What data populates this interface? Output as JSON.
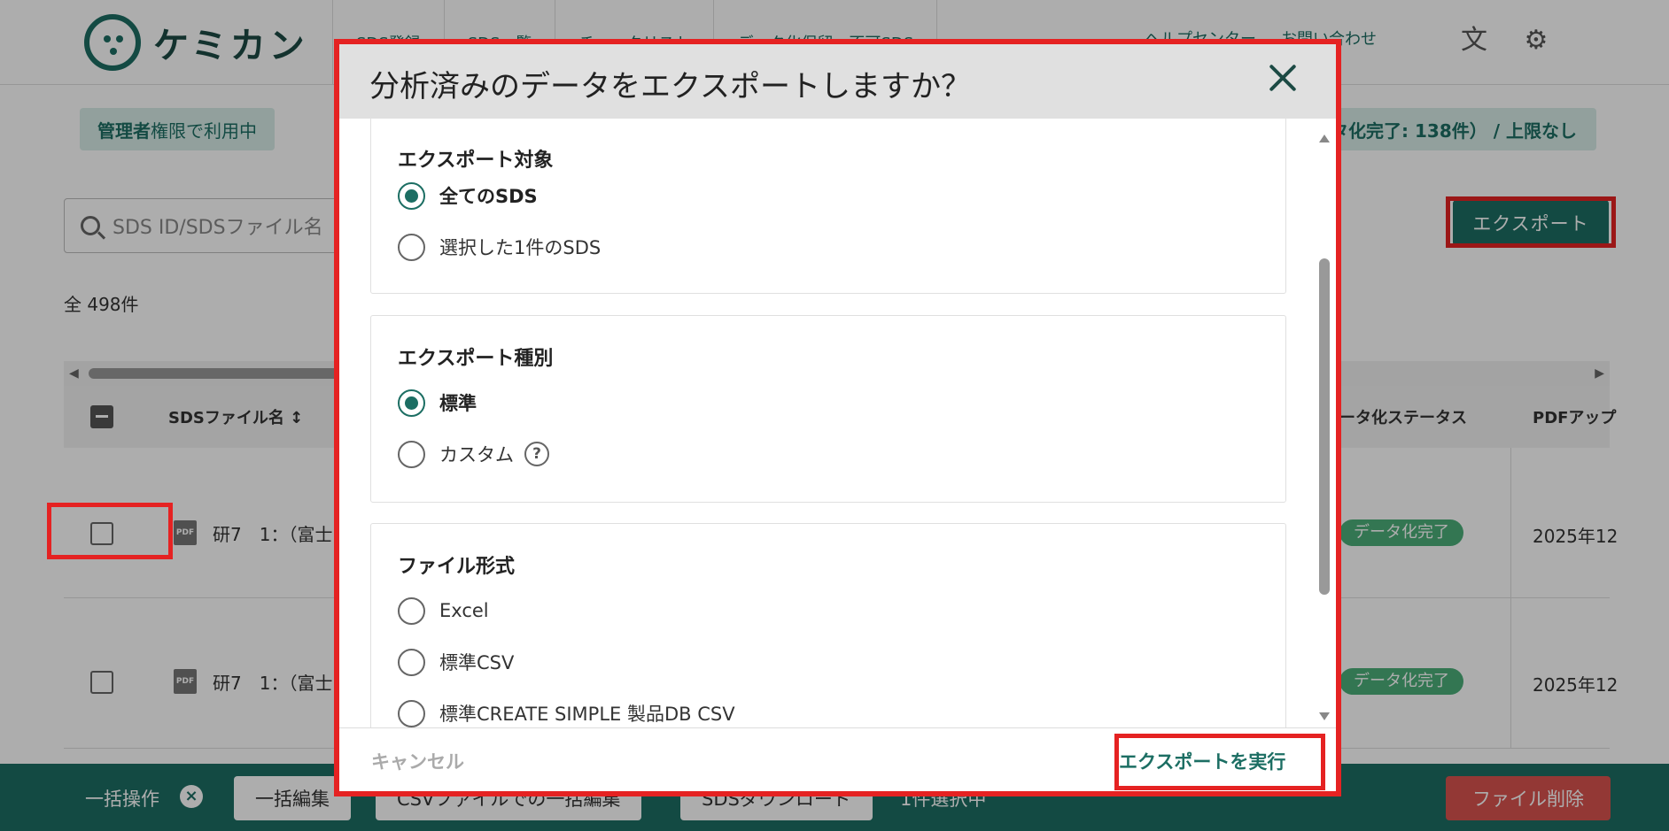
{
  "app": {
    "brand": "ケミカン",
    "nav": [
      "SDS登録",
      "SDS一覧",
      "チェックリスト",
      "データ化保留・不可SDS"
    ],
    "help_link": "ヘルプセンター",
    "contact_link": "お問い合わせ",
    "admin_badge_strong": "管理者",
    "admin_badge_rest": "権限で利用中",
    "quota_text": "タ化完了: 138件） / 上限なし",
    "search_placeholder": "SDS ID/SDSファイル名",
    "export_button": "エクスポート",
    "total_count": "全 498件"
  },
  "table": {
    "headers": {
      "filename": "SDSファイル名",
      "status": "ータ化ステータス",
      "uploaded": "PDFアップ"
    },
    "rows": [
      {
        "filename": "研7　1：（富士",
        "status": "データ化完了",
        "date": "2025年12"
      },
      {
        "filename": "研7　1：（富士",
        "status": "データ化完了",
        "date": "2025年12"
      }
    ]
  },
  "bulk_bar": {
    "label": "一括操作",
    "buttons": [
      "一括編集",
      "CSVファイルでの一括編集",
      "SDSダウンロード"
    ],
    "selected_count": "1件選択中",
    "delete_button": "ファイル削除"
  },
  "modal": {
    "title": "分析済みのデータをエクスポートしますか？",
    "sections": {
      "target": {
        "title": "エクスポート対象",
        "options": [
          {
            "label": "全てのSDS",
            "selected": true
          },
          {
            "label": "選択した1件のSDS",
            "selected": false
          }
        ]
      },
      "type": {
        "title": "エクスポート種別",
        "options": [
          {
            "label": "標準",
            "selected": true
          },
          {
            "label": "カスタム",
            "selected": false
          }
        ]
      },
      "format": {
        "title": "ファイル形式",
        "options": [
          {
            "label": "Excel",
            "selected": false
          },
          {
            "label": "標準CSV",
            "selected": false
          },
          {
            "label": "標準CREATE SIMPLE 製品DB CSV",
            "selected": false
          }
        ]
      }
    },
    "cancel_button": "キャンセル",
    "run_button": "エクスポートを実行"
  },
  "colors": {
    "brand": "#1c6e63",
    "highlight": "#e52222",
    "status_done": "#4caf7a",
    "danger": "#d9534f"
  }
}
